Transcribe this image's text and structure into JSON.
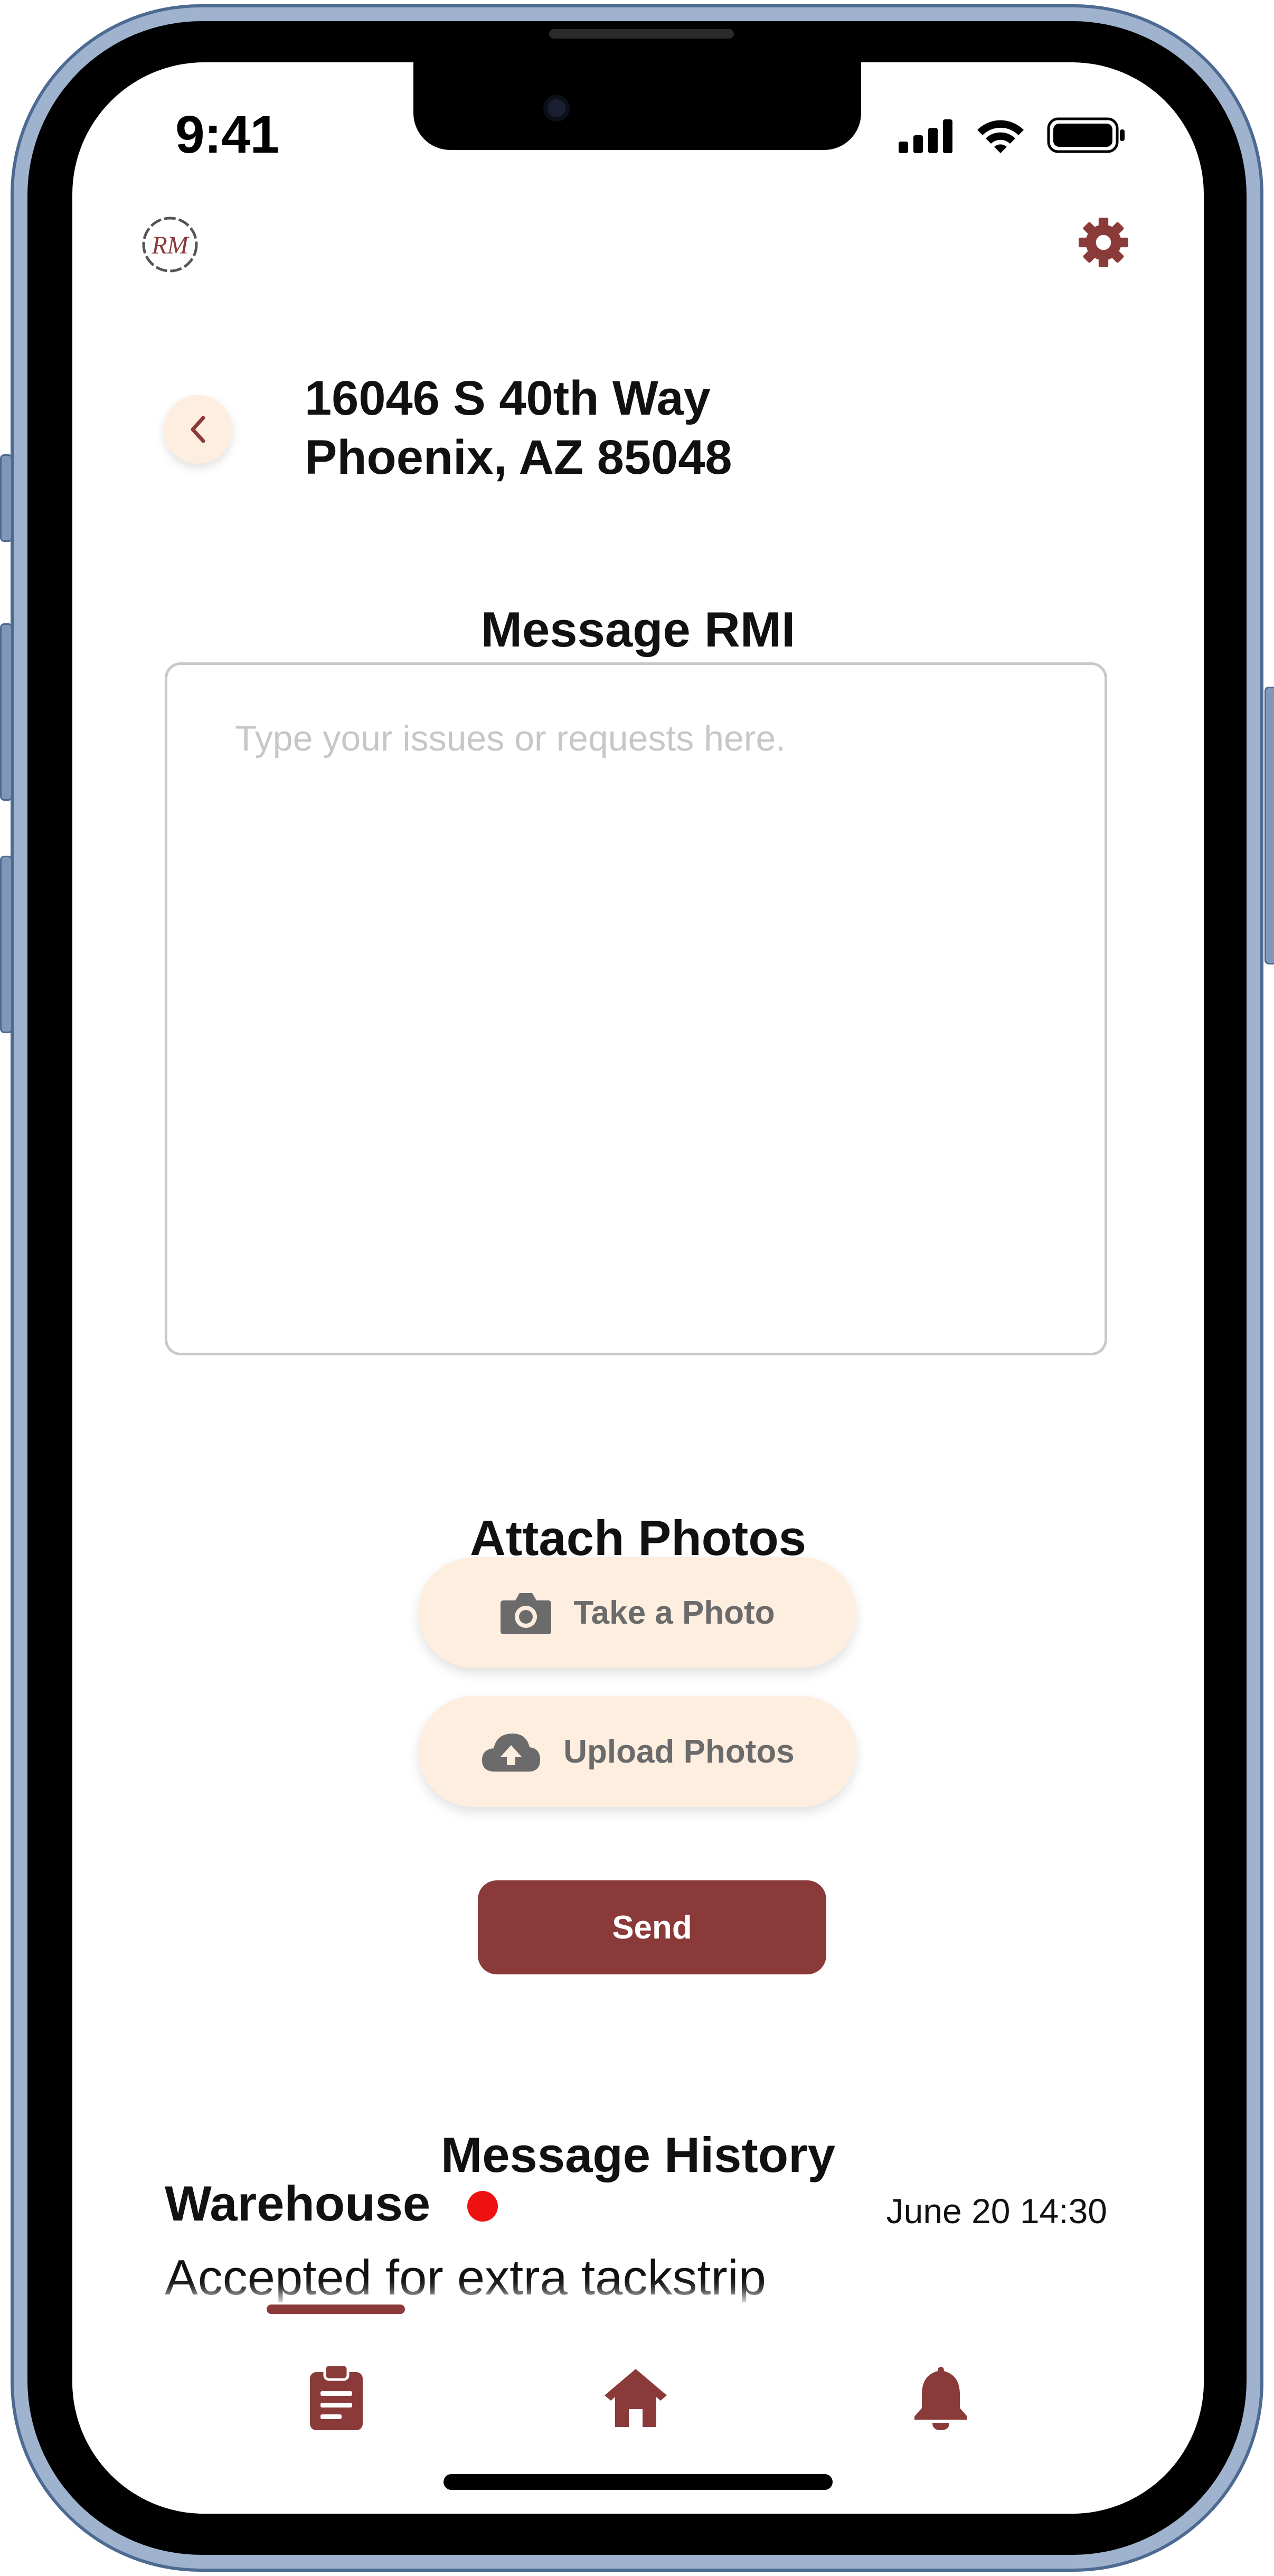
{
  "status_bar": {
    "time": "9:41"
  },
  "header": {
    "logo_text": "RM"
  },
  "address": {
    "line1": "16046 S 40th Way",
    "line2": "Phoenix, AZ 85048"
  },
  "message": {
    "title": "Message RMI",
    "placeholder": "Type your issues or requests here."
  },
  "attach": {
    "title": "Attach Photos",
    "take_photo_label": "Take a Photo",
    "upload_photos_label": "Upload Photos"
  },
  "send": {
    "label": "Send"
  },
  "history": {
    "title": "Message History",
    "items": [
      {
        "sender": "Warehouse",
        "date": "June 20 14:30",
        "text": "Accepted for extra tackstrip",
        "unread": true
      }
    ]
  },
  "nav": {
    "items": [
      "clipboard-icon",
      "home-icon",
      "bell-icon"
    ],
    "active_index": 0
  },
  "colors": {
    "accent": "#8b3a3a",
    "pill_bg": "#fdeee0",
    "unread": "#ee1111"
  }
}
